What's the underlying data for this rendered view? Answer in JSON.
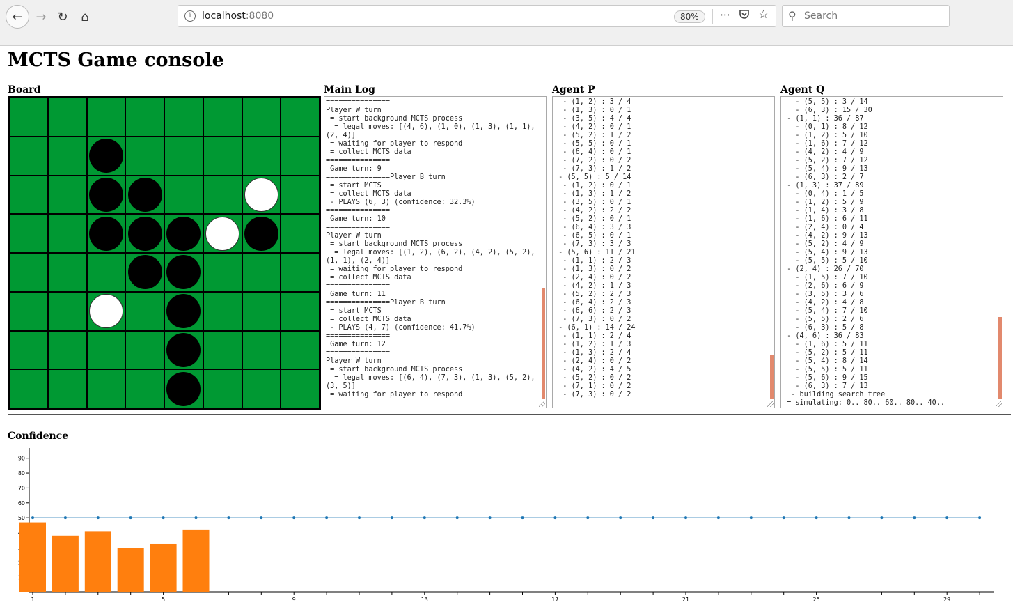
{
  "browser": {
    "url_host": "localhost",
    "url_port": ":8080",
    "zoom": "80%",
    "search_placeholder": "Search",
    "icons": [
      "back-arrow-icon",
      "forward-arrow-icon",
      "reload-icon",
      "home-icon",
      "info-icon",
      "more-icon",
      "pocket-icon",
      "bookmark-star-icon",
      "search-icon"
    ]
  },
  "page": {
    "title": "MCTS Game console"
  },
  "sections": {
    "board": "Board",
    "main_log": "Main Log",
    "agent_p": "Agent P",
    "agent_q": "Agent Q",
    "confidence": "Confidence"
  },
  "board": {
    "size": 8,
    "colors": {
      "board": "#009933",
      "black": "#000000",
      "white": "#ffffff"
    },
    "rows": [
      "........",
      "..B.....",
      "..BB..W.",
      "..BBBWB.",
      "...BB...",
      "..W.B...",
      "....B...",
      "....B..."
    ]
  },
  "logs": {
    "main": "===============\nPlayer W turn\n = start background MCTS process\n  = legal moves: [(4, 6), (1, 0), (1, 3), (1, 1),\n(2, 4)]\n = waiting for player to respond\n = collect MCTS data\n===============\n Game turn: 9\n===============Player B turn\n = start MCTS\n = collect MCTS data\n - PLAYS (6, 3) (confidence: 32.3%)\n===============\n Game turn: 10\n===============\nPlayer W turn\n = start background MCTS process\n  = legal moves: [(1, 2), (6, 2), (4, 2), (5, 2),\n(1, 1), (2, 4)]\n = waiting for player to respond\n = collect MCTS data\n===============\n Game turn: 11\n===============Player B turn\n = start MCTS\n = collect MCTS data\n - PLAYS (4, 7) (confidence: 41.7%)\n===============\n Game turn: 12\n===============\nPlayer W turn\n = start background MCTS process\n  = legal moves: [(6, 4), (7, 3), (1, 3), (5, 2),\n(3, 5)]\n = waiting for player to respond",
    "agent_p": "  - (1, 2) : 3 / 4\n  - (1, 3) : 0 / 1\n  - (3, 5) : 4 / 4\n  - (4, 2) : 0 / 1\n  - (5, 2) : 1 / 2\n  - (5, 5) : 0 / 1\n  - (6, 4) : 0 / 1\n  - (7, 2) : 0 / 2\n  - (7, 3) : 1 / 2\n - (5, 5) : 5 / 14\n  - (1, 2) : 0 / 1\n  - (1, 3) : 1 / 2\n  - (3, 5) : 0 / 1\n  - (4, 2) : 2 / 2\n  - (5, 2) : 0 / 1\n  - (6, 4) : 3 / 3\n  - (6, 5) : 0 / 1\n  - (7, 3) : 3 / 3\n - (5, 6) : 11 / 21\n  - (1, 1) : 2 / 3\n  - (1, 3) : 0 / 2\n  - (2, 4) : 0 / 2\n  - (4, 2) : 1 / 3\n  - (5, 2) : 2 / 3\n  - (6, 4) : 2 / 3\n  - (6, 6) : 2 / 3\n  - (7, 3) : 0 / 2\n - (6, 1) : 14 / 24\n  - (1, 1) : 2 / 4\n  - (1, 2) : 1 / 3\n  - (1, 3) : 2 / 4\n  - (2, 4) : 0 / 2\n  - (4, 2) : 4 / 5\n  - (5, 2) : 0 / 2\n  - (7, 1) : 0 / 2\n  - (7, 3) : 0 / 2",
    "agent_q": "   - (5, 5) : 3 / 14\n   - (6, 3) : 15 / 30\n - (1, 1) : 36 / 87\n   - (0, 1) : 8 / 12\n   - (1, 2) : 5 / 10\n   - (1, 6) : 7 / 12\n   - (4, 2) : 4 / 9\n   - (5, 2) : 7 / 12\n   - (5, 4) : 9 / 13\n   - (6, 3) : 2 / 7\n - (1, 3) : 37 / 89\n   - (0, 4) : 1 / 5\n   - (1, 2) : 5 / 9\n   - (1, 4) : 3 / 8\n   - (1, 6) : 6 / 11\n   - (2, 4) : 0 / 4\n   - (4, 2) : 9 / 13\n   - (5, 2) : 4 / 9\n   - (5, 4) : 9 / 13\n   - (5, 5) : 5 / 10\n - (2, 4) : 26 / 70\n   - (1, 5) : 7 / 10\n   - (2, 6) : 6 / 9\n   - (3, 5) : 3 / 6\n   - (4, 2) : 4 / 8\n   - (5, 4) : 7 / 10\n   - (5, 5) : 2 / 6\n   - (6, 3) : 5 / 8\n - (4, 6) : 36 / 83\n   - (1, 6) : 5 / 11\n   - (5, 2) : 5 / 11\n   - (5, 4) : 8 / 14\n   - (5, 5) : 5 / 11\n   - (5, 6) : 9 / 15\n   - (6, 3) : 7 / 13\n  - building search tree\n = simulating: 0.. 80.. 60.. 80.. 40.."
  },
  "chart_data": {
    "type": "bar",
    "title": "Confidence",
    "x": [
      1,
      2,
      3,
      4,
      5,
      6,
      7,
      8,
      9,
      10,
      11,
      12,
      13,
      14,
      15,
      16,
      17,
      18,
      19,
      20,
      21,
      22,
      23,
      24,
      25,
      26,
      27,
      28,
      29,
      30
    ],
    "xticks": [
      1,
      5,
      9,
      13,
      17,
      21,
      25,
      29
    ],
    "yticks": [
      10,
      20,
      30,
      40,
      50,
      60,
      70,
      80,
      90
    ],
    "ylim": [
      0,
      95
    ],
    "xlim": [
      0.5,
      30.5
    ],
    "bars": {
      "x": [
        1,
        2,
        3,
        4,
        5,
        6
      ],
      "values": [
        47,
        38,
        41,
        29.5,
        32.3,
        41.7
      ],
      "color": "#ff7f0e"
    },
    "reference_line": {
      "value": 50,
      "color": "#1f77b4"
    },
    "grid": false
  }
}
